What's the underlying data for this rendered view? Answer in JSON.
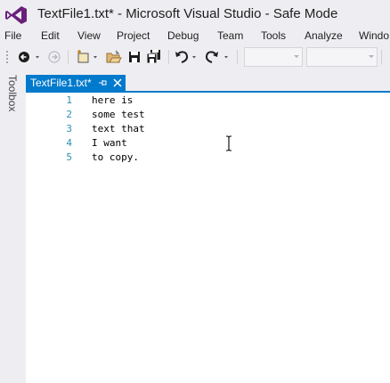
{
  "window": {
    "title": "TextFile1.txt* - Microsoft Visual Studio - Safe Mode"
  },
  "menu": [
    "File",
    "Edit",
    "View",
    "Project",
    "Debug",
    "Team",
    "Tools",
    "Analyze",
    "Windo"
  ],
  "toolbar": {
    "icons": [
      "back-arrow-icon",
      "forward-arrow-icon",
      "new-project-icon",
      "open-file-icon",
      "save-icon",
      "save-all-icon",
      "undo-icon",
      "redo-icon"
    ],
    "solution_configuration": "",
    "solution_platform": ""
  },
  "toolbox": {
    "label": "Toolbox"
  },
  "document_tab": {
    "label": "TextFile1.txt*"
  },
  "editor": {
    "lines": [
      {
        "number": "1",
        "text": "here is"
      },
      {
        "number": "2",
        "text": "some test"
      },
      {
        "number": "3",
        "text": "text that"
      },
      {
        "number": "4",
        "text": "I want"
      },
      {
        "number": "5",
        "text": "to copy."
      }
    ]
  },
  "colors": {
    "accent": "#007acc",
    "chrome": "#eeeef2",
    "logo": "#68217a",
    "line_number": "#2b91af"
  }
}
